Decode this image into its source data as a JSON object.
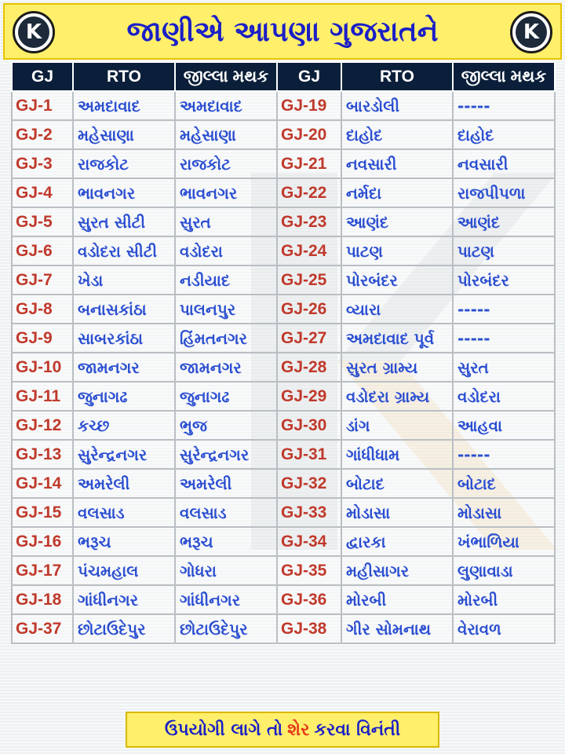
{
  "header": {
    "title": "જાણીએ આપણા ગુજરાતને",
    "logo_letter": "K"
  },
  "table": {
    "columns": [
      "GJ",
      "RTO",
      "જીલ્લા મથક",
      "GJ",
      "RTO",
      "જીલ્લા મથક"
    ],
    "rows": [
      [
        "GJ-1",
        "અમદાવાદ",
        "અમદાવાદ",
        "GJ-19",
        "બારડોલી",
        "-----"
      ],
      [
        "GJ-2",
        "મહેસાણા",
        "મહેસાણા",
        "GJ-20",
        "દાહોદ",
        "દાહોદ"
      ],
      [
        "GJ-3",
        "રાજકોટ",
        "રાજકોટ",
        "GJ-21",
        "નવસારી",
        "નવસારી"
      ],
      [
        "GJ-4",
        "ભાવનગર",
        "ભાવનગર",
        "GJ-22",
        "નર્મદા",
        "રાજપીપળા"
      ],
      [
        "GJ-5",
        "સુરત સીટી",
        "સુરત",
        "GJ-23",
        "આણંદ",
        "આણંદ"
      ],
      [
        "GJ-6",
        "વડોદરા સીટી",
        "વડોદરા",
        "GJ-24",
        "પાટણ",
        "પાટણ"
      ],
      [
        "GJ-7",
        "ખેડા",
        "નડીયાદ",
        "GJ-25",
        "પોરબંદર",
        "પોરબંદર"
      ],
      [
        "GJ-8",
        "બનાસકાંઠા",
        "પાલનપુર",
        "GJ-26",
        "વ્યારા",
        "-----"
      ],
      [
        "GJ-9",
        "સાબરકાંઠા",
        "હિંમતનગર",
        "GJ-27",
        "અમદાવાદ પૂર્વ",
        "-----"
      ],
      [
        "GJ-10",
        "જામનગર",
        "જામનગર",
        "GJ-28",
        "સુરત ગ્રામ્ય",
        "સુરત"
      ],
      [
        "GJ-11",
        "જુનાગઢ",
        "જુનાગઢ",
        "GJ-29",
        "વડોદરા ગ્રામ્ય",
        "વડોદરા"
      ],
      [
        "GJ-12",
        "કચ્છ",
        "ભુજ",
        "GJ-30",
        "ડાંગ",
        "આહવા"
      ],
      [
        "GJ-13",
        "સુરેન્દ્રનગર",
        "સુરેન્દ્રનગર",
        "GJ-31",
        "ગાંધીધામ",
        "-----"
      ],
      [
        "GJ-14",
        "અમરેલી",
        "અમરેલી",
        "GJ-32",
        "બોટાદ",
        "બોટાદ"
      ],
      [
        "GJ-15",
        "વલસાડ",
        "વલસાડ",
        "GJ-33",
        "મોડાસા",
        "મોડાસા"
      ],
      [
        "GJ-16",
        "ભરૂચ",
        "ભરૂચ",
        "GJ-34",
        "દ્વારકા",
        "ખંભાળિયા"
      ],
      [
        "GJ-17",
        "પંચમહાલ",
        "ગોધરા",
        "GJ-35",
        "મહીસાગર",
        "લુણાવાડા"
      ],
      [
        "GJ-18",
        "ગાંધીનગર",
        "ગાંધીનગર",
        "GJ-36",
        "મોરબી",
        "મોરબી"
      ],
      [
        "GJ-37",
        "છોટાઉદેપુર",
        "છોટાઉદેપુર",
        "GJ-38",
        "ગીર સોમનાથ",
        "વેરાવળ"
      ]
    ]
  },
  "footer": {
    "text_before": "ઉપયોગી લાગે તો",
    "highlight": "શેર",
    "text_after": "કરવા વિનંતી"
  },
  "colors": {
    "header_bg": "#ffef6a",
    "title": "#1a1fc7",
    "table_head_bg": "#0b1f3a",
    "code_text": "#c0392b",
    "cell_text": "#2b4fd1",
    "footer_highlight": "#e53a1d"
  }
}
